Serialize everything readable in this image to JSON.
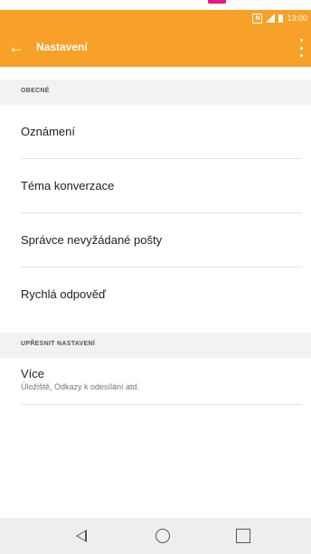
{
  "status_bar": {
    "time": "13:00",
    "nfc_label": "N",
    "icons": [
      "nfc-icon",
      "signal-icon",
      "battery-icon"
    ]
  },
  "app_bar": {
    "title": "Nastavení",
    "back_icon": "arrow-left-icon",
    "menu_icon": "overflow-menu-icon",
    "color": "#f7a128"
  },
  "sections": [
    {
      "header": "OBECNÉ",
      "items": [
        {
          "title": "Oznámení"
        },
        {
          "title": "Téma konverzace"
        },
        {
          "title": "Správce nevyžádané pošty"
        },
        {
          "title": "Rychlá odpověď"
        }
      ]
    },
    {
      "header": "UPŘESNIT NASTAVENÍ",
      "items": [
        {
          "title": "Více",
          "subtitle": "Úložiště, Odkazy k odesílání atd."
        }
      ]
    }
  ],
  "nav_bar": {
    "buttons": [
      "back-triangle-icon",
      "home-circle-icon",
      "recents-square-icon"
    ]
  }
}
